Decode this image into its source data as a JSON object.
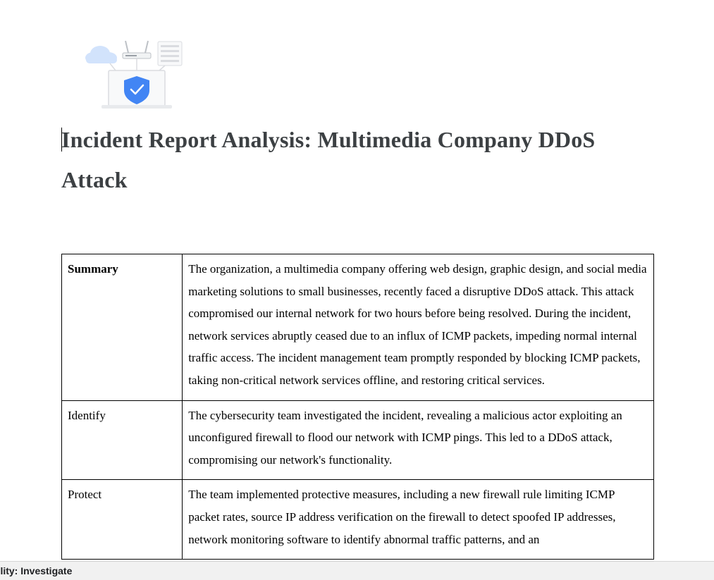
{
  "document": {
    "title": "Incident Report Analysis: Multimedia Company DDoS Attack",
    "rows": [
      {
        "label": "Summary",
        "text": "The organization, a multimedia company offering web design, graphic design, and social media marketing solutions to small businesses, recently faced a disruptive DDoS attack. This attack compromised our internal network for two hours before being resolved. During the incident, network services abruptly ceased due to an influx of ICMP packets, impeding normal internal traffic access. The incident management team promptly responded by blocking ICMP packets, taking non-critical network services offline, and restoring critical services."
      },
      {
        "label": "Identify",
        "text": "The cybersecurity team investigated the incident, revealing a malicious actor exploiting an unconfigured firewall to flood our network with ICMP pings. This led to a DDoS attack, compromising our network's functionality."
      },
      {
        "label": "Protect",
        "text": "The team implemented protective measures, including a new firewall rule limiting ICMP packet rates, source IP address verification on the firewall to detect spoofed IP addresses, network monitoring software to identify abnormal traffic patterns, and an"
      }
    ]
  },
  "illustration": {
    "icon": "network-security-shield-illustration",
    "colors": {
      "cloud": "#d2e3fc",
      "shield": "#4285f4",
      "laptop": "#e8eaed"
    }
  },
  "statusbar": {
    "text": "bility: Investigate"
  }
}
